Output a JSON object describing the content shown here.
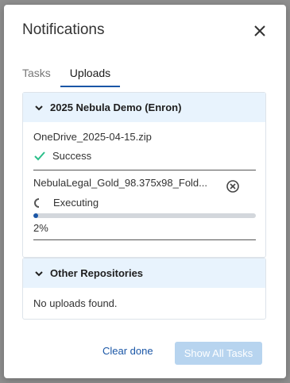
{
  "dialog": {
    "title": "Notifications",
    "close_icon": "close-icon"
  },
  "tabs": [
    {
      "label": "Tasks",
      "active": false
    },
    {
      "label": "Uploads",
      "active": true
    }
  ],
  "groups": {
    "nebula": {
      "header": "2025 Nebula Demo (Enron)",
      "uploads": [
        {
          "file": "OneDrive_2025-04-15.zip",
          "status": "Success",
          "status_icon": "check-icon"
        },
        {
          "file": "NebulaLegal_Gold_98.375x98_Fold...",
          "status": "Executing",
          "status_icon": "spinner-icon",
          "progress": 0.02,
          "progress_text": "2%",
          "cancel_icon": "cancel-circle-icon"
        }
      ]
    },
    "other": {
      "header": "Other Repositories",
      "empty_text": "No uploads found."
    }
  },
  "footer": {
    "clear_label": "Clear done",
    "show_all_label": "Show All Tasks"
  },
  "colors": {
    "accent": "#1a56a6",
    "success": "#2bbf8a",
    "group_header_bg": "#e8f3fd",
    "disabled_button": "#b7d4ef"
  }
}
